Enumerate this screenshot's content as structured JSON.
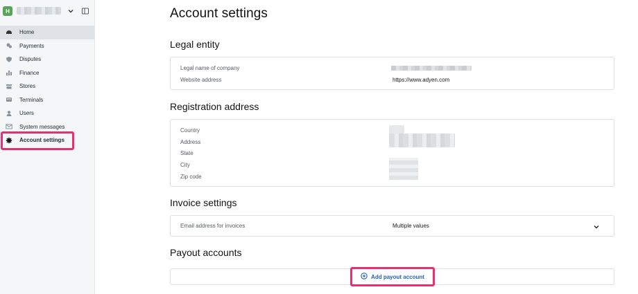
{
  "sidebar": {
    "avatar_letter": "H",
    "items": [
      {
        "label": "Home",
        "icon": "home-icon"
      },
      {
        "label": "Payments",
        "icon": "payments-icon"
      },
      {
        "label": "Disputes",
        "icon": "shield-icon"
      },
      {
        "label": "Finance",
        "icon": "bar-chart-icon"
      },
      {
        "label": "Stores",
        "icon": "store-icon"
      },
      {
        "label": "Terminals",
        "icon": "terminal-icon"
      },
      {
        "label": "Users",
        "icon": "user-icon"
      },
      {
        "label": "System messages",
        "icon": "envelope-icon"
      },
      {
        "label": "Account settings",
        "icon": "gear-icon"
      }
    ]
  },
  "main": {
    "title": "Account settings",
    "legal_entity": {
      "title": "Legal entity",
      "rows": [
        {
          "label": "Legal name of company",
          "value": ""
        },
        {
          "label": "Website address",
          "value": "https://www.adyen.com"
        }
      ]
    },
    "registration_address": {
      "title": "Registration address",
      "rows": [
        {
          "label": "Country"
        },
        {
          "label": "Address"
        },
        {
          "label": "State"
        },
        {
          "label": "City"
        },
        {
          "label": "Zip code"
        }
      ]
    },
    "invoice_settings": {
      "title": "Invoice settings",
      "label": "Email address for invoices",
      "value": "Multiple values"
    },
    "payout_accounts": {
      "title": "Payout accounts",
      "add_label": "Add payout account"
    }
  },
  "colors": {
    "highlight": "#e8306f",
    "link": "#1f5fbf",
    "avatar": "#5aa45a"
  }
}
